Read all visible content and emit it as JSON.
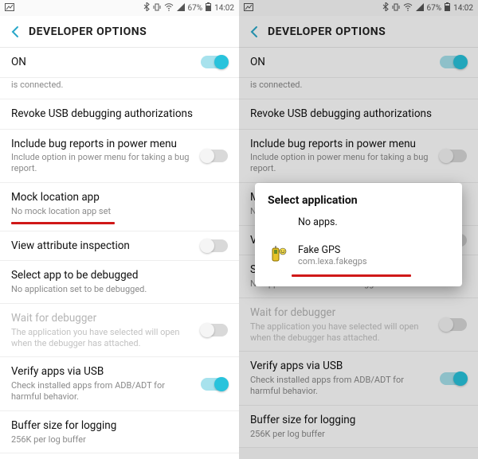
{
  "status": {
    "battery_pct": "67%",
    "time": "14:02"
  },
  "header": {
    "title": "DEVELOPER OPTIONS"
  },
  "rows": {
    "on": {
      "title": "ON"
    },
    "connected_sub": "is connected.",
    "revoke": {
      "title": "Revoke USB debugging authorizations"
    },
    "bugreport": {
      "title": "Include bug reports in power menu",
      "sub": "Include option in power menu for taking a bug report."
    },
    "mock": {
      "title": "Mock location app",
      "sub": "No mock location app set"
    },
    "viewattr": {
      "title": "View attribute inspection"
    },
    "selectdbg": {
      "title": "Select app to be debugged",
      "sub": "No application set to be debugged."
    },
    "waitdbg": {
      "title": "Wait for debugger",
      "sub": "The application you have selected will open when the debugger has attached."
    },
    "verifyusb": {
      "title": "Verify apps via USB",
      "sub": "Check installed apps from ADB/ADT for harmful behavior."
    },
    "bufsize": {
      "title": "Buffer size for logging",
      "sub": "256K per log buffer"
    }
  },
  "dialog": {
    "title": "Select application",
    "noapps": "No apps.",
    "item": {
      "name": "Fake GPS",
      "pkg": "com.lexa.fakegps"
    }
  }
}
